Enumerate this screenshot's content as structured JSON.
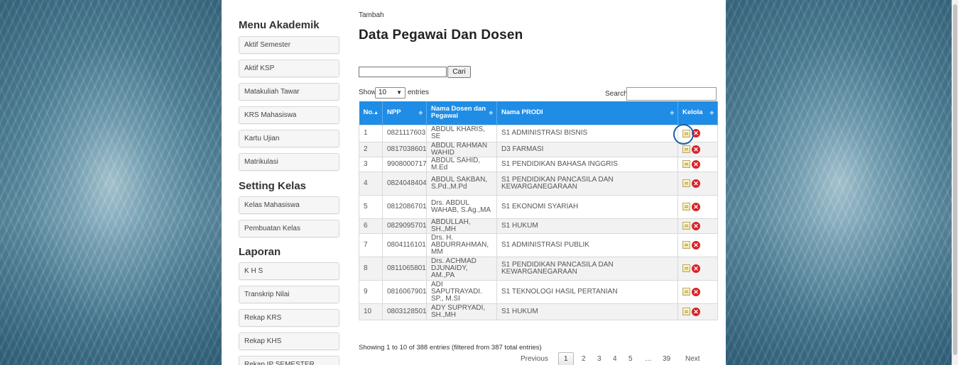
{
  "sidebar": {
    "sections": [
      {
        "title": "Menu Akademik",
        "items": [
          "Aktif Semester",
          "Aktif KSP",
          "Matakuliah Tawar",
          "KRS Mahasiswa",
          "Kartu Ujian",
          "Matrikulasi"
        ]
      },
      {
        "title": "Setting Kelas",
        "items": [
          "Kelas Mahasiswa",
          "Pembuatan Kelas"
        ]
      },
      {
        "title": "Laporan",
        "items": [
          "K H S",
          "Transkrip Nilai",
          "Rekap KRS",
          "Rekap KHS",
          "Rekap IP SEMESTER"
        ]
      }
    ]
  },
  "main": {
    "tambah_label": "Tambah",
    "title": "Data Pegawai Dan Dosen",
    "search_value": "",
    "cari_label": "Cari",
    "show_label": "Show",
    "entries_value": "10",
    "entries_label": "entries",
    "search_label": "Search:",
    "table": {
      "headers": [
        "No.",
        "NPP",
        "Nama Dosen dan Pegawai",
        "Nama PRODI",
        "Kelola"
      ],
      "rows": [
        [
          "1",
          "0821117603",
          "ABDUL KHARIS, SE",
          "S1 ADMINISTRASI BISNIS"
        ],
        [
          "2",
          "0817038601",
          "ABDUL RAHMAN WAHID",
          "D3 FARMASI"
        ],
        [
          "3",
          "9908000717",
          "ABDUL SAHID, M.Ed",
          "S1 PENDIDIKAN BAHASA INGGRIS"
        ],
        [
          "4",
          "0824048404",
          "ABDUL SAKBAN, S.Pd.,M.Pd",
          "S1 PENDIDIKAN PANCASILA DAN KEWARGANEGARAAN"
        ],
        [
          "5",
          "0812086701",
          "Drs. ABDUL WAHAB, S.Ag.,MA",
          "S1 EKONOMI SYARIAH"
        ],
        [
          "6",
          "0829095701",
          "ABDULLAH, SH.,MH",
          "S1 HUKUM"
        ],
        [
          "7",
          "0804116101",
          "Drs. H. ABDURRAHMAN, MM",
          "S1 ADMINISTRASI PUBLIK"
        ],
        [
          "8",
          "0811065801",
          "Drs. ACHMAD DJUNAIDY, AM.,PA",
          "S1 PENDIDIKAN PANCASILA DAN KEWARGANEGARAAN"
        ],
        [
          "9",
          "0816067901",
          "ADI SAPUTRAYADI. SP., M.SI",
          "S1 TEKNOLOGI HASIL PERTANIAN"
        ],
        [
          "10",
          "0803128501",
          "ADY SUPRYADI, SH.,MH",
          "S1 HUKUM"
        ]
      ]
    },
    "info_text": "Showing 1 to 10 of 388 entries (filtered from 387 total entries)",
    "pagination": {
      "previous": "Previous",
      "pages": [
        "1",
        "2",
        "3",
        "4",
        "5"
      ],
      "ellipsis": "…",
      "last": "39",
      "next": "Next",
      "current": "1"
    }
  },
  "icons": {
    "edit": "edit-note-icon",
    "delete": "delete-x-icon"
  },
  "colors": {
    "header_blue": "#1f8de5",
    "delete_red": "#d8232a",
    "highlight_ring": "#1a5fa8"
  }
}
